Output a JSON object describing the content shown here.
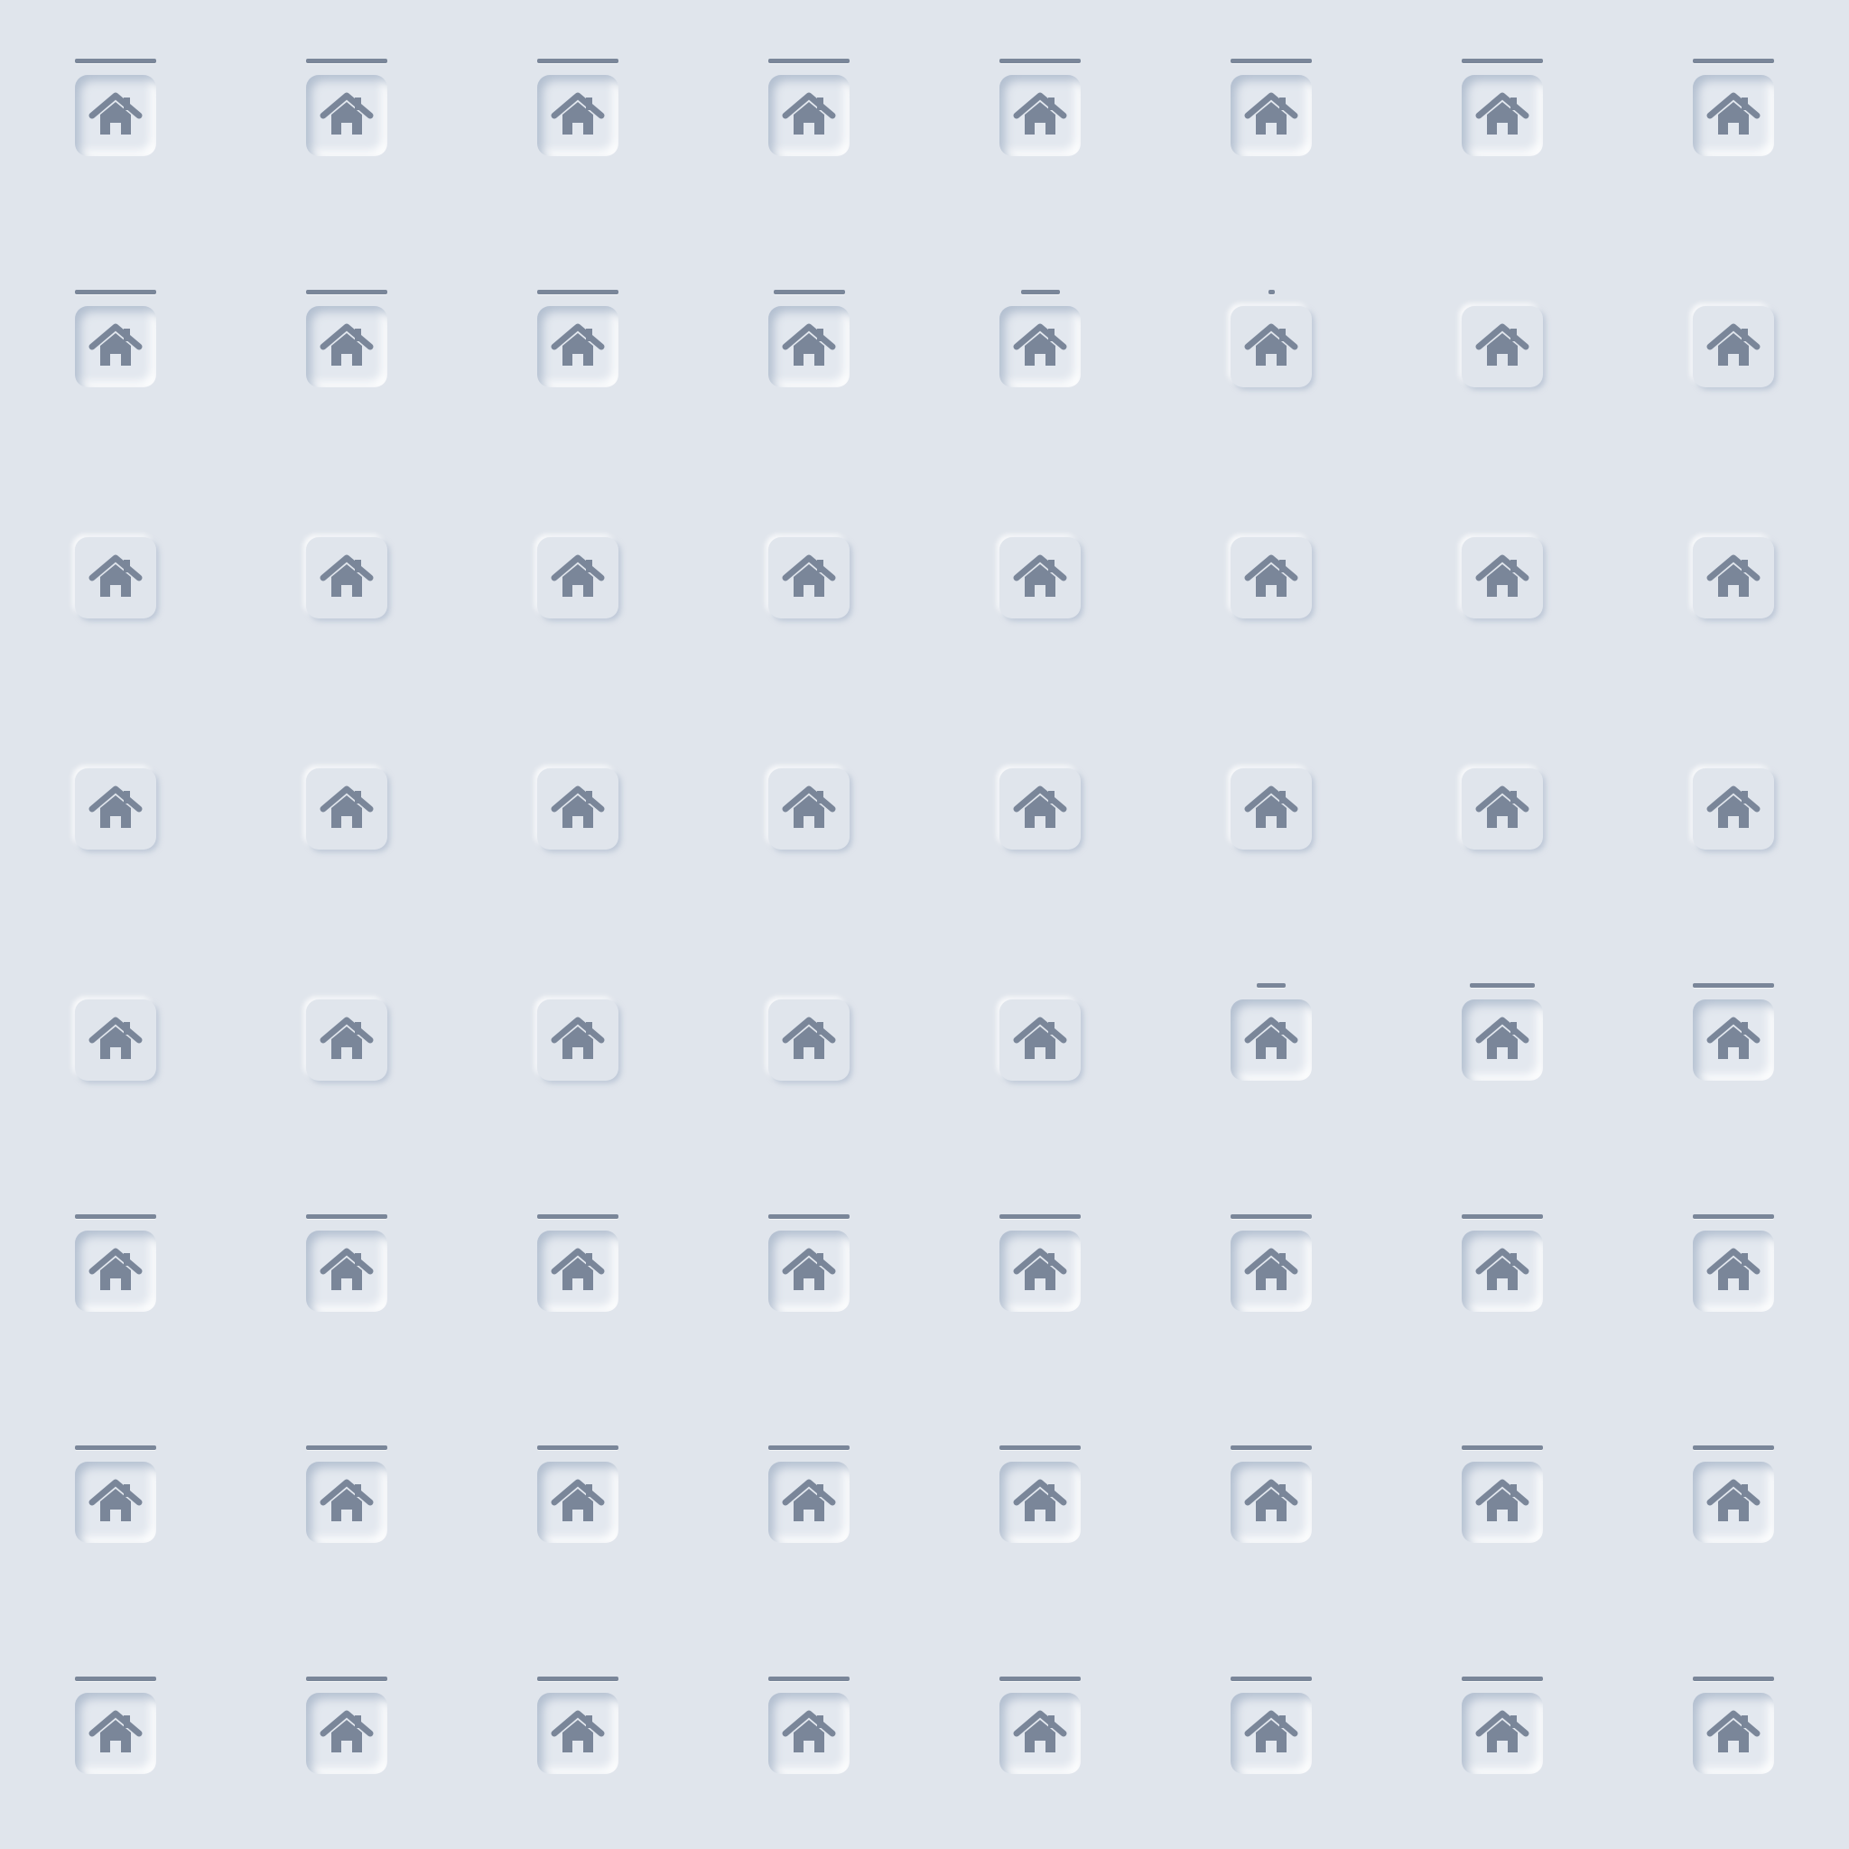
{
  "theme": {
    "background": "#e0e5ec",
    "icon_color": "#7a8699",
    "indicator_color": "#7a8699"
  },
  "buttons": {
    "icon": "home-icon",
    "rows": [
      [
        "pressed",
        "pressed",
        "pressed",
        "pressed",
        "pressed",
        "pressed",
        "pressed",
        "pressed"
      ],
      [
        "pressed",
        "pressed",
        "pressed",
        "pressed",
        "pressed",
        "raised",
        "raised",
        "raised"
      ],
      [
        "raised",
        "raised",
        "raised",
        "raised",
        "raised",
        "raised",
        "raised",
        "raised"
      ],
      [
        "raised",
        "raised",
        "raised",
        "raised",
        "raised",
        "raised",
        "raised",
        "raised"
      ],
      [
        "raised",
        "raised",
        "raised",
        "raised",
        "raised",
        "pressed",
        "pressed",
        "pressed"
      ],
      [
        "pressed",
        "pressed",
        "pressed",
        "pressed",
        "pressed",
        "pressed",
        "pressed",
        "pressed"
      ],
      [
        "pressed",
        "pressed",
        "pressed",
        "pressed",
        "pressed",
        "pressed",
        "pressed",
        "pressed"
      ],
      [
        "pressed",
        "pressed",
        "pressed",
        "pressed",
        "pressed",
        "pressed",
        "pressed",
        "pressed"
      ]
    ],
    "indicator_fill": [
      [
        1,
        1,
        1,
        1,
        1,
        1,
        1,
        1
      ],
      [
        1,
        1,
        1,
        0.88,
        0.48,
        0.08,
        0,
        0
      ],
      [
        0,
        0,
        0,
        0,
        0,
        0,
        0,
        0
      ],
      [
        0,
        0,
        0,
        0,
        0,
        0,
        0,
        0
      ],
      [
        0,
        0,
        0,
        0,
        0,
        0.36,
        0.8,
        1
      ],
      [
        1,
        1,
        1,
        1,
        1,
        1,
        1,
        1
      ],
      [
        1,
        1,
        1,
        1,
        1,
        1,
        1,
        1
      ],
      [
        1,
        1,
        1,
        1,
        1,
        1,
        1,
        1
      ]
    ]
  }
}
